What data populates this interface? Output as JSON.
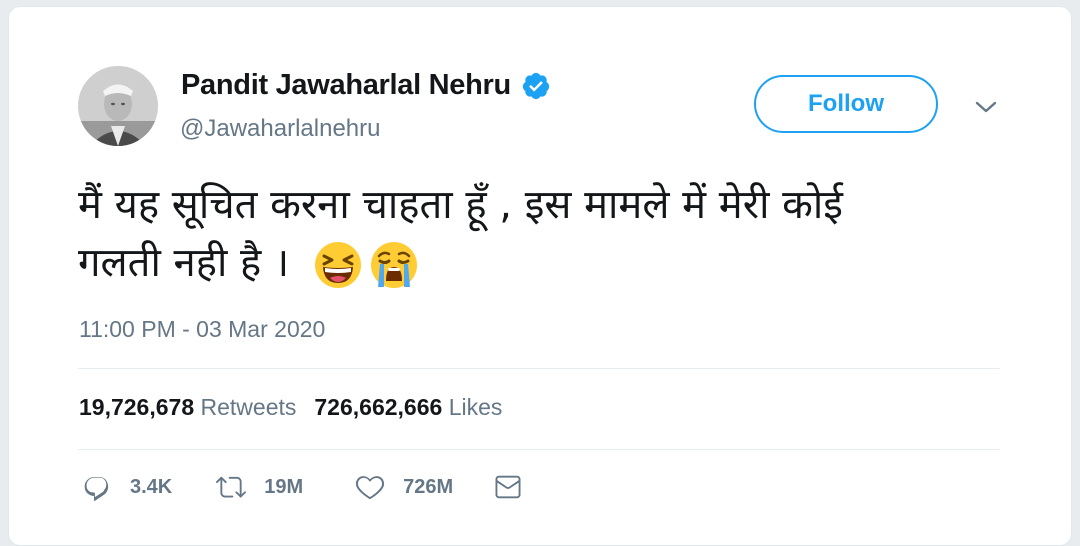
{
  "tweet": {
    "display_name": "Pandit Jawaharlal Nehru",
    "handle": "@Jawaharlalnehru",
    "follow_label": "Follow",
    "text_line1": "मैं यह सूचित करना चाहता हूँ , इस मामले में मेरी कोई",
    "text_line2": "गलती नही है ।",
    "emojis": [
      "laughing-emoji",
      "crying-emoji"
    ],
    "timestamp": "11:00 PM - 03 Mar 2020",
    "stats": {
      "retweets_count": "19,726,678",
      "retweets_label": "Retweets",
      "likes_count": "726,662,666",
      "likes_label": "Likes"
    },
    "actions": {
      "reply_count": "3.4K",
      "retweet_count": "19M",
      "like_count": "726M"
    }
  },
  "colors": {
    "accent": "#1da1f2",
    "secondary_text": "#657786",
    "primary_text": "#14171a"
  }
}
